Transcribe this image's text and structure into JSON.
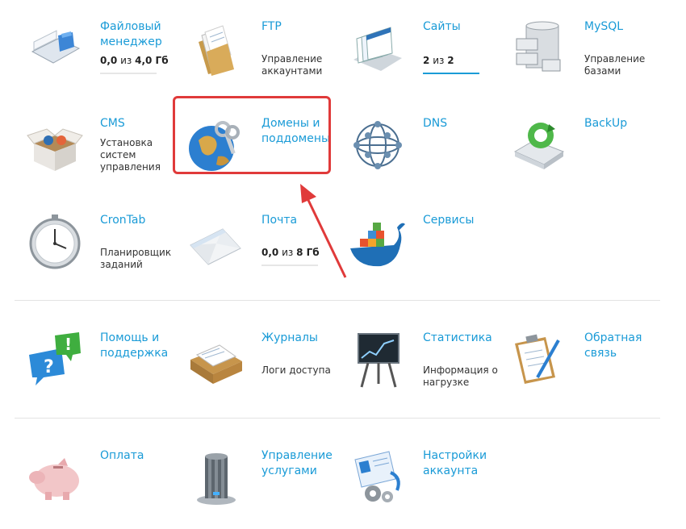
{
  "tiles": {
    "file_manager": {
      "title": "Файловый менеджер",
      "quota": "0,0",
      "of": "из",
      "total": "4,0 Гб",
      "fill": 0
    },
    "ftp": {
      "title": "FTP",
      "desc": "Управление аккаунтами"
    },
    "sites": {
      "title": "Сайты",
      "quota": "2",
      "of": "из",
      "total": "2",
      "fill": 1
    },
    "mysql": {
      "title": "MySQL",
      "desc": "Управление базами"
    },
    "cms": {
      "title": "CMS",
      "desc": "Установка систем управления"
    },
    "domains": {
      "title": "Домены и поддомены"
    },
    "dns": {
      "title": "DNS"
    },
    "backup": {
      "title": "BackUp"
    },
    "crontab": {
      "title": "CronTab",
      "desc": "Планировщик заданий"
    },
    "mail": {
      "title": "Почта",
      "quota": "0,0",
      "of": "из",
      "total": "8 Гб",
      "fill": 0
    },
    "services": {
      "title": "Сервисы"
    },
    "help": {
      "title": "Помощь и поддержка"
    },
    "logs": {
      "title": "Журналы",
      "desc": "Логи доступа"
    },
    "stats": {
      "title": "Статистика",
      "desc": "Информация о нагрузке"
    },
    "feedback": {
      "title": "Обратная связь"
    },
    "payment": {
      "title": "Оплата"
    },
    "services_manage": {
      "title": "Управление услугами"
    },
    "account_settings": {
      "title": "Настройки аккаунта"
    }
  },
  "icons": {
    "file_manager": "folder-icon",
    "ftp": "files-folder-icon",
    "sites": "windows-stack-icon",
    "mysql": "database-drawers-icon",
    "cms": "open-box-icon",
    "domains": "globe-keys-icon",
    "dns": "network-sphere-icon",
    "backup": "hard-drive-refresh-icon",
    "crontab": "clock-icon",
    "mail": "envelope-icon",
    "services": "whale-containers-icon",
    "help": "speech-bubbles-icon",
    "logs": "document-tray-icon",
    "stats": "chart-easel-icon",
    "feedback": "clipboard-pen-icon",
    "payment": "piggy-bank-icon",
    "services_manage": "server-cylinder-icon",
    "account_settings": "id-card-gears-icon"
  },
  "colors": {
    "link": "#1a9bd7",
    "highlight": "#e03a3a"
  }
}
